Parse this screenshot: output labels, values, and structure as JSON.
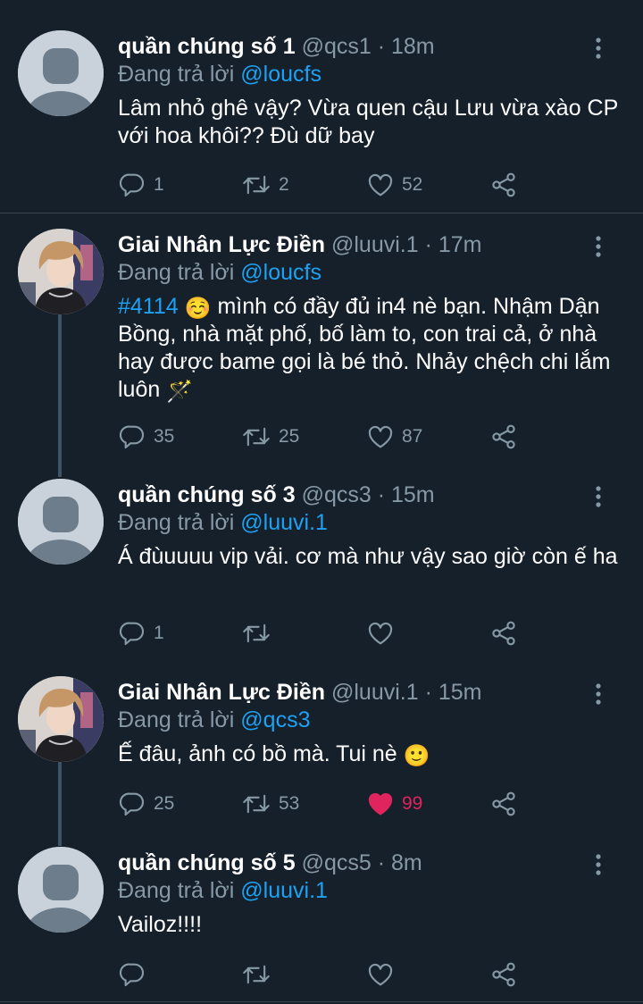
{
  "tweets": [
    {
      "name": "quần chúng số 1",
      "handle": "@qcs1",
      "time": "18m",
      "reply_prefix": "Đang trả lời",
      "reply_to": "@loucfs",
      "text": "Lâm nhỏ ghê vậy? Vừa quen cậu Lưu vừa xào CP với hoa khôi?? Đù dữ bay",
      "replies": "1",
      "retweets": "2",
      "likes": "52",
      "liked": false,
      "avatar": "default-avatar"
    },
    {
      "name": "Giai Nhân Lực Điền",
      "handle": "@luuvi.1",
      "time": "17m",
      "reply_prefix": "Đang trả lời",
      "reply_to": "@loucfs",
      "hashtag": "#4114",
      "emoji": "☺️",
      "text": "mình có đầy đủ in4 nè bạn. Nhậm Dận Bồng, nhà mặt phố, bố làm to, con trai cả, ở nhà hay được bame gọi là bé thỏ. Nhảy chệch chi lắm luôn",
      "text_emoji": "🪄",
      "replies": "35",
      "retweets": "25",
      "likes": "87",
      "liked": false,
      "avatar": "profile-photo"
    },
    {
      "name": "quần chúng số 3",
      "handle": "@qcs3",
      "time": "15m",
      "reply_prefix": "Đang trả lời",
      "reply_to": "@luuvi.1",
      "text": "Á đùuuuu vip vải. cơ mà như vậy sao giờ còn ế ha",
      "replies": "1",
      "retweets": "",
      "likes": "",
      "liked": false,
      "avatar": "default-avatar"
    },
    {
      "name": "Giai Nhân Lực Điền",
      "handle": "@luuvi.1",
      "time": "15m",
      "reply_prefix": "Đang trả lời",
      "reply_to": "@qcs3",
      "text": "Ế đâu, ảnh có bồ mà. Tui nè",
      "text_emoji": "🙂",
      "replies": "25",
      "retweets": "53",
      "likes": "99",
      "liked": true,
      "avatar": "profile-photo"
    },
    {
      "name": "quần chúng số 5",
      "handle": "@qcs5",
      "time": "8m",
      "reply_prefix": "Đang trả lời",
      "reply_to": "@luuvi.1",
      "text": "Vailoz!!!!",
      "replies": "",
      "retweets": "",
      "likes": "",
      "liked": false,
      "avatar": "default-avatar"
    }
  ],
  "colors": {
    "background": "#15202b",
    "text": "#ffffff",
    "secondary": "#8899a6",
    "link": "#1da1f2",
    "like": "#e0245e",
    "thread_line": "#3d5466"
  }
}
